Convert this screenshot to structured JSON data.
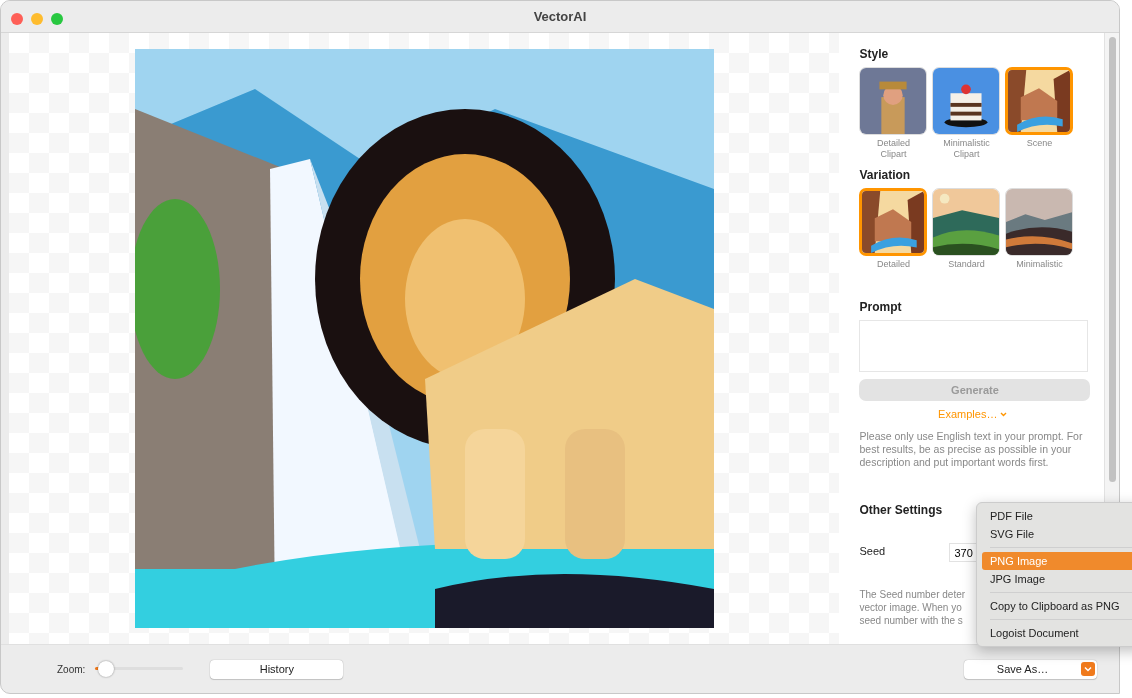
{
  "window": {
    "title": "VectorAI"
  },
  "sidebar": {
    "style": {
      "heading": "Style",
      "options": [
        {
          "label": "Detailed\nClipart",
          "selected": false
        },
        {
          "label": "Minimalistic\nClipart",
          "selected": false
        },
        {
          "label": "Scene",
          "selected": true
        }
      ]
    },
    "variation": {
      "heading": "Variation",
      "options": [
        {
          "label": "Detailed",
          "selected": true
        },
        {
          "label": "Standard",
          "selected": false
        },
        {
          "label": "Minimalistic",
          "selected": false
        }
      ]
    },
    "prompt": {
      "heading": "Prompt",
      "generate": {
        "label": "Generate",
        "disabled": true
      },
      "examples": "Examples…",
      "help": "Please only use English text in your prompt. For best results, be as precise as possible in your description and put important words first."
    },
    "other_settings": {
      "heading": "Other Settings",
      "seed_label": "Seed",
      "seed_value": "370",
      "description_lines": [
        "The Seed number deter",
        "vector image. When yo",
        "seed number with the s"
      ]
    }
  },
  "bottom_bar": {
    "zoom_label": "Zoom:",
    "zoom": {
      "level": 0.07
    },
    "history": "History",
    "save_as": "Save As…"
  },
  "save_menu": {
    "groups": [
      [
        {
          "label": "PDF File",
          "selected": false
        },
        {
          "label": "SVG File",
          "selected": false
        }
      ],
      [
        {
          "label": "PNG Image",
          "selected": true
        },
        {
          "label": "JPG Image",
          "selected": false
        }
      ],
      [
        {
          "label": "Copy to Clipboard as PNG",
          "selected": false
        }
      ],
      [
        {
          "label": "Logoist Document",
          "selected": false
        }
      ]
    ]
  }
}
